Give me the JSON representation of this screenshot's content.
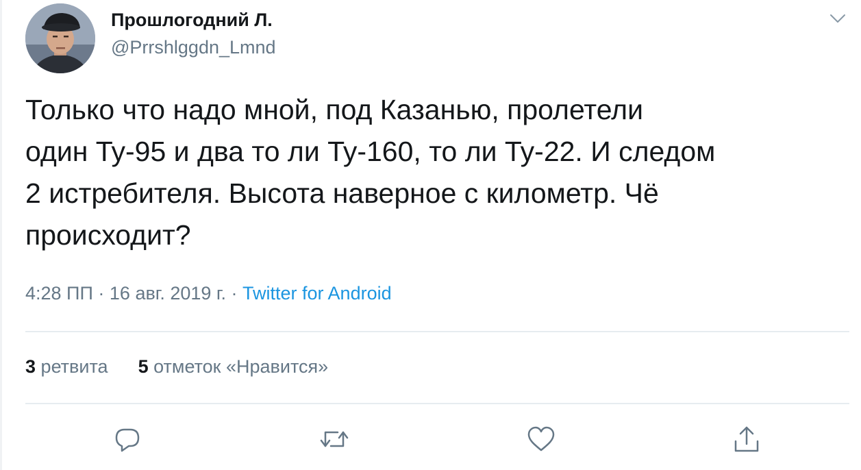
{
  "author": {
    "display_name": "Прошлогодний Л.",
    "handle": "@Prrshlggdn_Lmnd"
  },
  "tweet": {
    "text": "Только что надо мной, под Казанью, пролетели\nодин Ту-95 и два то ли Ту-160, то ли Ту-22. И следом\n2 истребителя. Высота наверное с километр. Чё\nпроисходит?",
    "time": "4:28 ПП",
    "separator": "·",
    "date": "16 авг. 2019 г.",
    "source": "Twitter for Android"
  },
  "stats": {
    "retweets_count": "3",
    "retweets_label": "ретвита",
    "likes_count": "5",
    "likes_label": "отметок «Нравится»"
  },
  "icons": {
    "caret": "chevron-down-icon",
    "reply": "reply-icon",
    "retweet": "retweet-icon",
    "like": "heart-icon",
    "share": "share-icon"
  },
  "colors": {
    "text": "#14171a",
    "secondary": "#657786",
    "link": "#1b95e0",
    "divider": "#e6ecf0"
  }
}
